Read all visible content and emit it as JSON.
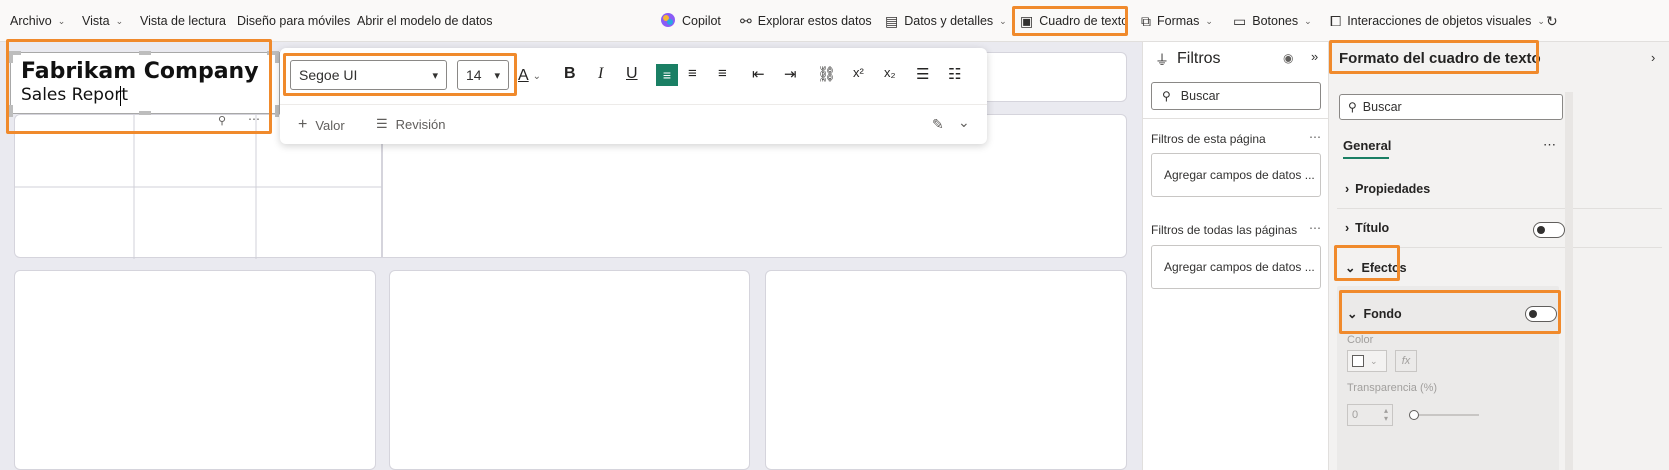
{
  "ribbon": {
    "archivo": "Archivo",
    "vista": "Vista",
    "vista_lectura": "Vista de lectura",
    "diseno_moviles": "Diseño para móviles",
    "abrir_modelo": "Abrir el modelo de datos",
    "copilot": "Copilot",
    "explorar": "Explorar estos datos",
    "datos_detalles": "Datos y detalles",
    "cuadro_texto": "Cuadro de texto",
    "formas": "Formas",
    "botones": "Botones",
    "interacciones": "Interacciones de objetos visuales"
  },
  "textbox": {
    "title": "Fabrikam Company",
    "subtitle": "Sales Report"
  },
  "toolbar": {
    "font": "Segoe UI",
    "size": "14",
    "valor": "Valor",
    "revision": "Revisión"
  },
  "filters": {
    "title": "Filtros",
    "search_placeholder": "Buscar",
    "page_label": "Filtros de esta página",
    "page_add": "Agregar campos de datos ...",
    "all_label": "Filtros de todas las páginas",
    "all_add": "Agregar campos de datos ..."
  },
  "format": {
    "title": "Formato del cuadro de texto",
    "search_placeholder": "Buscar",
    "tab": "General",
    "propiedades": "Propiedades",
    "titulo": "Título",
    "efectos": "Efectos",
    "fondo": "Fondo",
    "color_label": "Color",
    "fx": "fx",
    "transparencia_label": "Transparencia (%)",
    "transparencia_value": "0"
  },
  "colors": {
    "highlight": "#f08a2c",
    "accent_green": "#1a7f64"
  }
}
